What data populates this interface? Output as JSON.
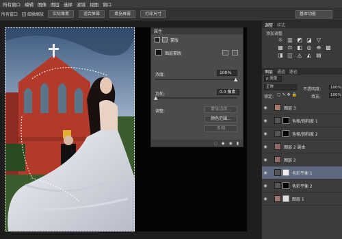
{
  "menubar": {
    "items": [
      "所有窗口",
      "编辑",
      "图像",
      "图层",
      "选择",
      "滤镜",
      "视图",
      "窗口"
    ]
  },
  "options": {
    "all_windows": "所有窗口",
    "scrubby_zoom": "细微缩放",
    "buttons": [
      "实际像素",
      "适合屏幕",
      "填充屏幕",
      "打印尺寸"
    ],
    "workspace": "基本功能"
  },
  "properties": {
    "tab": "属性",
    "type": "蒙版",
    "subtitle": "图层蒙版",
    "density_label": "浓度:",
    "density": "100%",
    "feather_label": "羽化:",
    "feather": "0.0 像素",
    "adjust_label": "调整:",
    "btn_mask_edge": "蒙版边缘...",
    "btn_color_range": "颜色范围...",
    "btn_invert": "反相"
  },
  "adjustments": {
    "tab1": "调整",
    "tab2": "样式",
    "title": "添加调整"
  },
  "layers": {
    "tab1": "图层",
    "tab2": "通道",
    "tab3": "路径",
    "kind": "ρ 类型",
    "blend": "正常",
    "opacity_label": "不透明度:",
    "opacity": "100%",
    "lock_label": "锁定:",
    "fill_label": "填充:",
    "fill": "100%",
    "rows": [
      {
        "name": "图层 3"
      },
      {
        "name": "色相/饱和度 1"
      },
      {
        "name": "色相/饱和度 2"
      },
      {
        "name": "图层 2 副本"
      },
      {
        "name": "图层 2"
      },
      {
        "name": "色彩平衡 1"
      },
      {
        "name": "色彩平衡 2"
      },
      {
        "name": "图层 1"
      }
    ]
  }
}
